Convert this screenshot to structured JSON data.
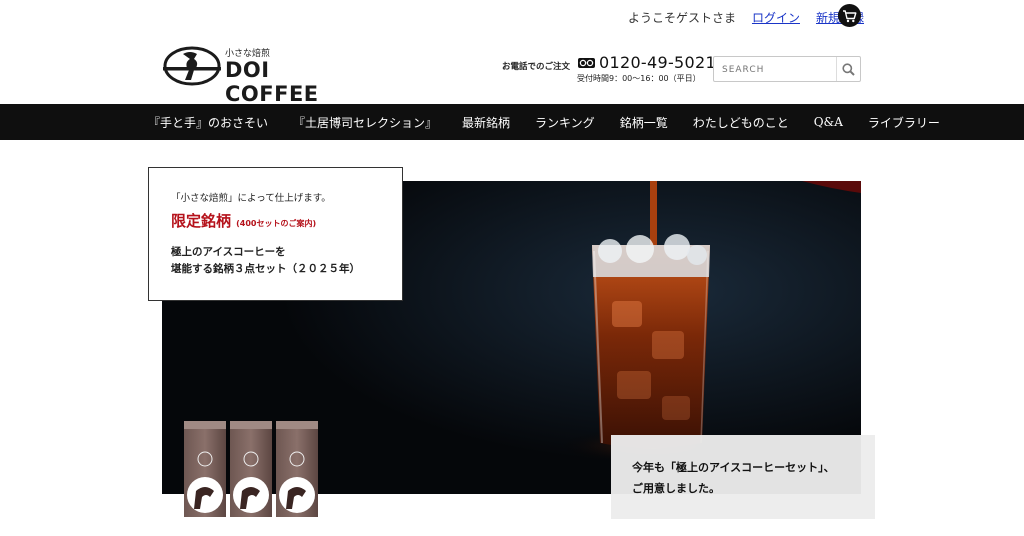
{
  "header": {
    "greeting": "ようこそゲストさま",
    "login_label": "ログイン",
    "register_label": "新規登録",
    "cart_icon": "cart-icon"
  },
  "logo": {
    "tagline": "小さな焙煎",
    "name": "DOI COFFEE"
  },
  "contact": {
    "label": "お電話でのご注文",
    "phone_icon": "free-dial-icon",
    "number": "0120-49-5021",
    "hours": "受付時間9：00〜16：00（平日）"
  },
  "search": {
    "placeholder": "SEARCH",
    "button_icon": "search-icon"
  },
  "nav": {
    "items": [
      {
        "label": "『手と手』のおさそい"
      },
      {
        "label": "『土居博司セレクション』"
      },
      {
        "label": "最新銘柄"
      },
      {
        "label": "ランキング"
      },
      {
        "label": "銘柄一覧"
      },
      {
        "label": "わたしどものこと"
      },
      {
        "label": "Q&A"
      },
      {
        "label": "ライブラリー"
      }
    ]
  },
  "hero": {
    "promo": {
      "pretext": "「小さな焙煎」によって仕上げます。",
      "limited": "限定銘柄",
      "limited_note": "(400セットのご案内)",
      "desc_line1": "極上のアイスコーヒーを",
      "desc_line2": "堪能する銘柄３点セット（２０２５年）"
    },
    "caption": {
      "line1": "今年も「極上のアイスコーヒーセット」、",
      "line2": "ご用意しました。"
    }
  },
  "colors": {
    "accent_red": "#b5121b",
    "nav_bg": "#0f0f0f",
    "link_blue": "#1a35c7"
  }
}
